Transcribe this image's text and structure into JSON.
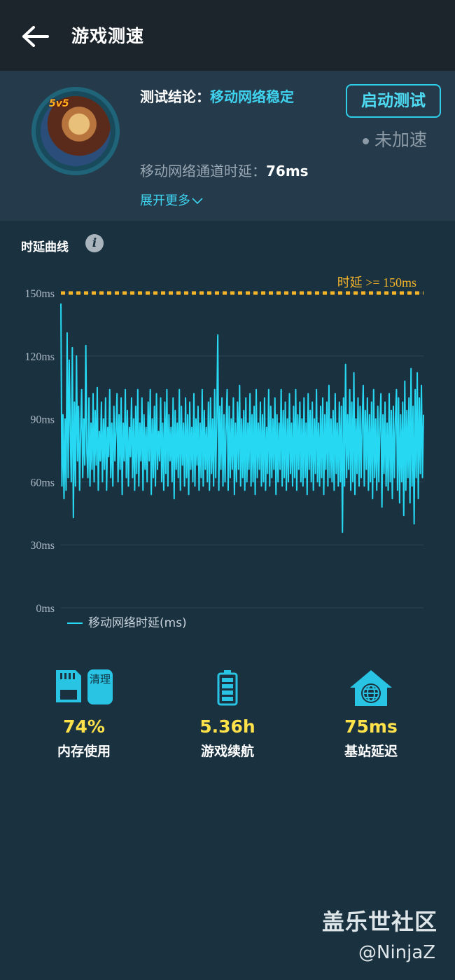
{
  "header": {
    "title": "游戏测速",
    "back_icon": "back-arrow-icon"
  },
  "summary": {
    "conclusion_label": "测试结论：",
    "conclusion_value": "移动网络稳定",
    "start_button": "启动测试",
    "status": "未加速",
    "latency_label": "移动网络通道时延：",
    "latency_value": "76ms",
    "expand_more": "展开更多",
    "avatar_badge": "5v5"
  },
  "chart_section": {
    "title": "时延曲线",
    "info_icon": "info-icon"
  },
  "chart_data": {
    "type": "line",
    "ylim": [
      0,
      150
    ],
    "y_ticks": [
      "150ms",
      "120ms",
      "90ms",
      "60ms",
      "30ms",
      "0ms"
    ],
    "threshold": {
      "value": 150,
      "label": "时延 >= 150ms",
      "color": "#f5b52a"
    },
    "series": [
      {
        "name": "移动网络时延(ms)",
        "color": "#27d8f3",
        "values": [
          145,
          58,
          92,
          52,
          90,
          56,
          131,
          62,
          118,
          84,
          60,
          124,
          43,
          98,
          58,
          120,
          70,
          96,
          56,
          84,
          104,
          62,
          90,
          68,
          125,
          74,
          62,
          100,
          58,
          88,
          66,
          102,
          60,
          94,
          68,
          105,
          56,
          84,
          70,
          98,
          60,
          90,
          66,
          100,
          56,
          86,
          72,
          104,
          62,
          88,
          58,
          96,
          70,
          84,
          102,
          60,
          92,
          66,
          100,
          54,
          88,
          70,
          104,
          62,
          94,
          58,
          86,
          72,
          100,
          62,
          90,
          56,
          96,
          64,
          104,
          58,
          88,
          70,
          100,
          56,
          92,
          66,
          86,
          60,
          98,
          70,
          104,
          54,
          90,
          62,
          96,
          58,
          102,
          66,
          84,
          70,
          100,
          60,
          88,
          56,
          98,
          64,
          104,
          58,
          92,
          70,
          86,
          60,
          100,
          52,
          94,
          66,
          88,
          62,
          104,
          56,
          96,
          68,
          88,
          58,
          100,
          62,
          92,
          54,
          98,
          66,
          86,
          60,
          102,
          58,
          90,
          68,
          96,
          56,
          88,
          62,
          104,
          58,
          94,
          66,
          86,
          60,
          98,
          56,
          100,
          64,
          90,
          58,
          104,
          62,
          88,
          130,
          56,
          96,
          66,
          100,
          58,
          92,
          60,
          86,
          104,
          56,
          96,
          62,
          90,
          66,
          100,
          54,
          88,
          60,
          98,
          66,
          106,
          58,
          90,
          62,
          94,
          56,
          100,
          60,
          88,
          66,
          102,
          58,
          92,
          60,
          96,
          54,
          104,
          62,
          88,
          66,
          98,
          58,
          92,
          60,
          100,
          56,
          86,
          64,
          104,
          58,
          96,
          62,
          90,
          66,
          100,
          54,
          92,
          60,
          88,
          66,
          104,
          58,
          94,
          62,
          98,
          56,
          90,
          60,
          102,
          64,
          88,
          58,
          96,
          62,
          104,
          56,
          92,
          66,
          98,
          60,
          90,
          58,
          100,
          62,
          88,
          54,
          102,
          66,
          94,
          60,
          98,
          56,
          90,
          64,
          104,
          60,
          88,
          58,
          96,
          62,
          100,
          54,
          92,
          66,
          98,
          58,
          106,
          62,
          90,
          60,
          94,
          56,
          102,
          64,
          88,
          58,
          98,
          60,
          96,
          36,
          100,
          58,
          116,
          62,
          92,
          66,
          104,
          56,
          98,
          60,
          112,
          54,
          90,
          64,
          100,
          58,
          96,
          62,
          88,
          106,
          58,
          94,
          66,
          100,
          56,
          92,
          60,
          98,
          52,
          104,
          62,
          90,
          56,
          96,
          60,
          86,
          102,
          48,
          92,
          64,
          98,
          58,
          88,
          56,
          102,
          60,
          94,
          52,
          96,
          62,
          90,
          104,
          56,
          100,
          50,
          92,
          60,
          98,
          44,
          108,
          56,
          94,
          62,
          100,
          50,
          114,
          58,
          96,
          40,
          104,
          62,
          112,
          52,
          100,
          64,
          106,
          62,
          92
        ]
      }
    ]
  },
  "stats": [
    {
      "value": "74%",
      "label": "内存使用",
      "icon": "sd-card-icon",
      "button": "清理"
    },
    {
      "value": "5.36h",
      "label": "游戏续航",
      "icon": "battery-icon"
    },
    {
      "value": "75ms",
      "label": "基站延迟",
      "icon": "base-station-icon"
    }
  ],
  "watermark": {
    "line1": "盖乐世社区",
    "line2": "@NinjaZ"
  },
  "colors": {
    "accent": "#27d8f3",
    "highlight": "#ffe14a",
    "threshold": "#f5b52a",
    "background": "#1a3140"
  }
}
